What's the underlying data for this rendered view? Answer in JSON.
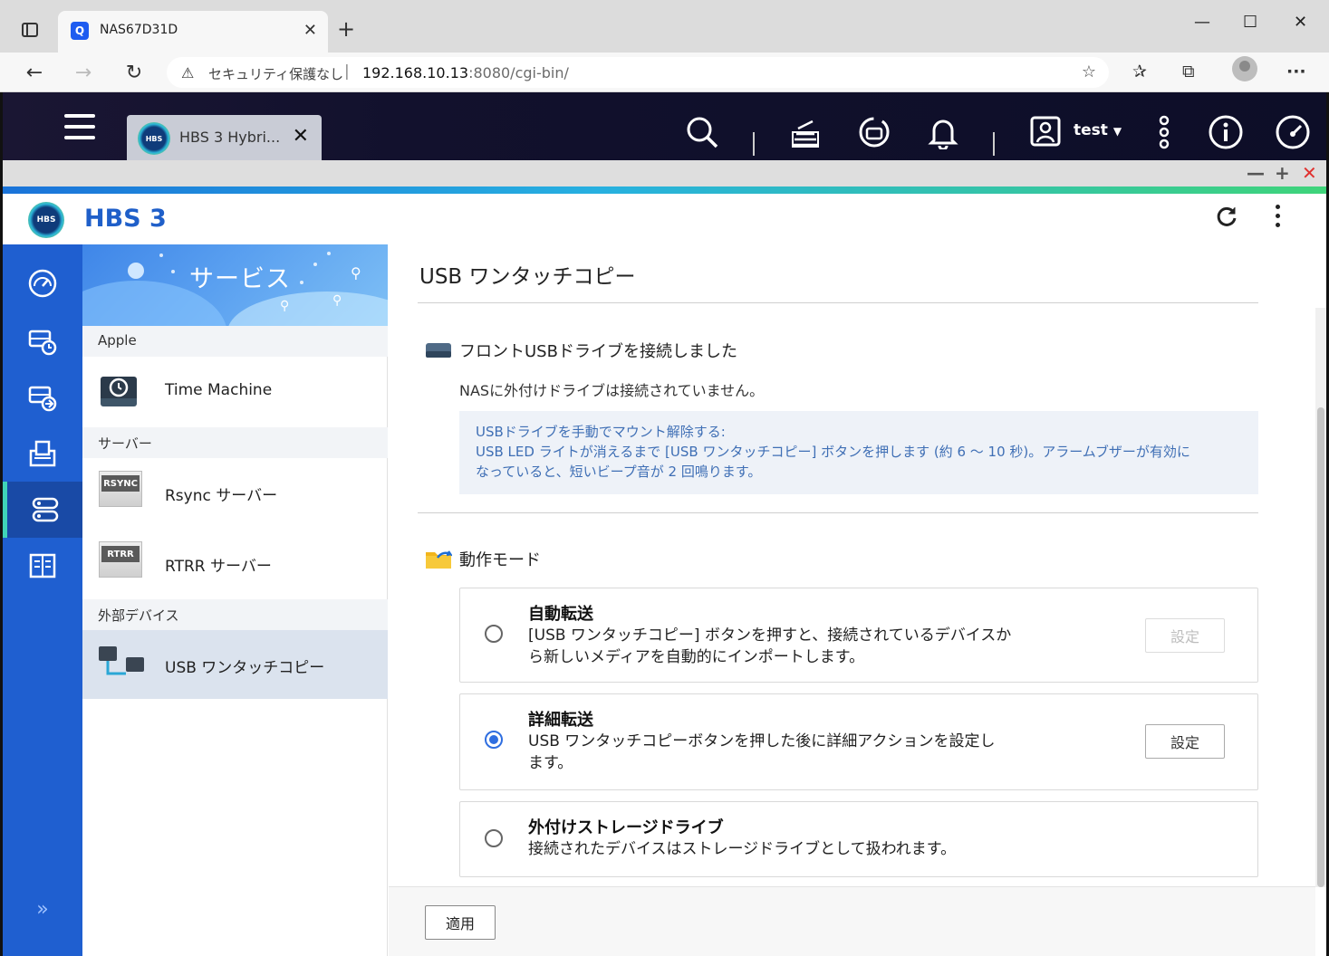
{
  "browser": {
    "tab_title": "NAS67D31D",
    "tab_favicon": "Q",
    "security_label": "セキュリティ保護なし",
    "url_host": "192.168.10.13",
    "url_path": ":8080/cgi-bin/"
  },
  "qts": {
    "app_tab_label": "HBS 3 Hybri...",
    "app_tab_logo": "HBS",
    "username": "test"
  },
  "app": {
    "title": "HBS 3",
    "logo_text": "HBS"
  },
  "service_panel": {
    "banner_title": "サービス",
    "groups": [
      {
        "label": "Apple",
        "items": [
          {
            "label": "Time Machine",
            "icon": "time-machine-icon"
          }
        ]
      },
      {
        "label": "サーバー",
        "items": [
          {
            "label": "Rsync サーバー",
            "icon": "rsync-server-icon",
            "plate": "RSYNC"
          },
          {
            "label": "RTRR サーバー",
            "icon": "rtrr-server-icon",
            "plate": "RTRR"
          }
        ]
      },
      {
        "label": "外部デバイス",
        "items": [
          {
            "label": "USB ワンタッチコピー",
            "icon": "usb-one-touch-copy-icon",
            "selected": true
          }
        ]
      }
    ]
  },
  "main": {
    "page_title": "USB ワンタッチコピー",
    "front_usb_heading": "フロントUSBドライブを接続しました",
    "front_usb_status": "NASに外付けドライブは接続されていません。",
    "notice_line1": "USBドライブを手動でマウント解除する:",
    "notice_line2": "USB LED ライトが消えるまで [USB ワンタッチコピー] ボタンを押します (約 6 ～ 10 秒)。アラームブザーが有効に",
    "notice_line3": "なっていると、短いビープ音が 2 回鳴ります。",
    "mode_heading": "動作モード",
    "options": [
      {
        "title": "自動転送",
        "desc1": "[USB ワンタッチコピー] ボタンを押すと、接続されているデバイスか",
        "desc2": "ら新しいメディアを自動的にインポートします。",
        "button": "設定",
        "selected": false,
        "button_enabled": false
      },
      {
        "title": "詳細転送",
        "desc1": "USB ワンタッチコピーボタンを押した後に詳細アクションを設定し",
        "desc2": "ます。",
        "button": "設定",
        "selected": true,
        "button_enabled": true
      },
      {
        "title": "外付けストレージドライブ",
        "desc1": "接続されたデバイスはストレージドライブとして扱われます。",
        "selected": false
      }
    ],
    "apply_label": "適用"
  },
  "colors": {
    "accent": "#1f5fc9",
    "rail": "#1f5fd0",
    "close_red": "#e0312f"
  }
}
